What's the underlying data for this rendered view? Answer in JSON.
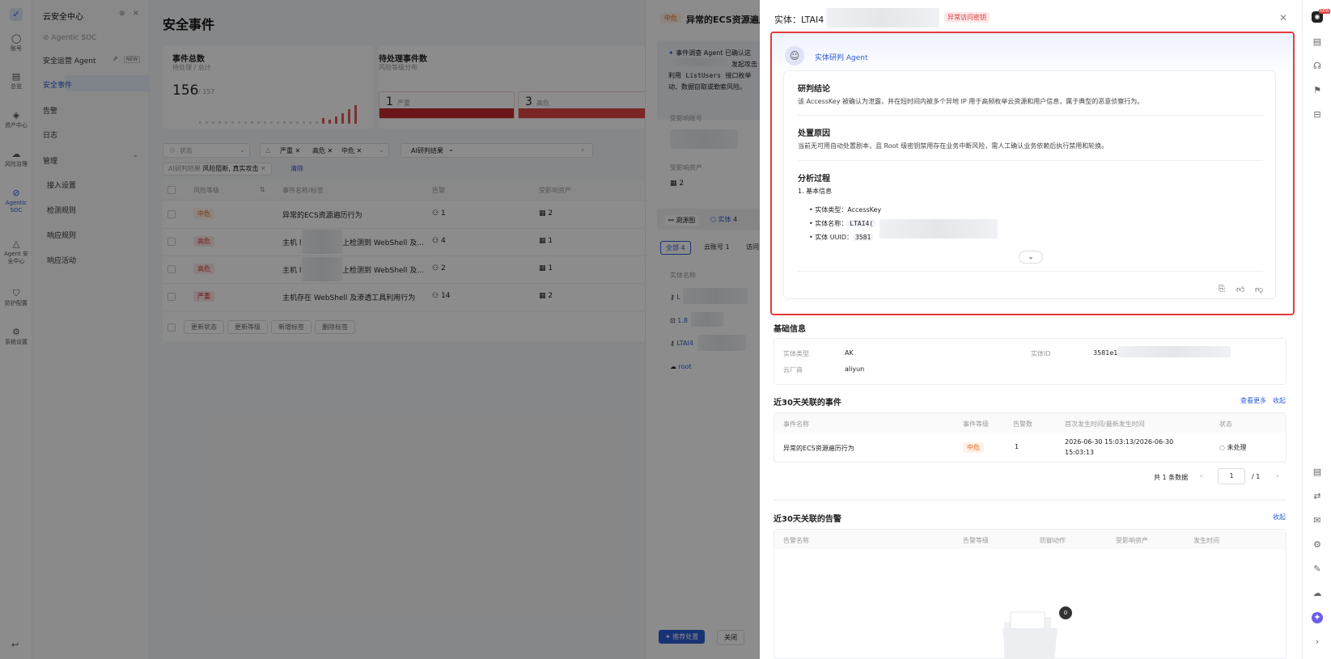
{
  "rail": {
    "items": [
      {
        "label": "账号",
        "icon": "user-icon"
      },
      {
        "label": "总览",
        "icon": "dashboard-icon"
      },
      {
        "label": "资产中心",
        "icon": "cube-icon"
      },
      {
        "label": "风险治理",
        "icon": "cloud-icon"
      },
      {
        "label": "Agentic SOC",
        "icon": "agentic-icon"
      },
      {
        "label": "Agent 安全中心",
        "icon": "triangle-icon"
      },
      {
        "label": "防护配置",
        "icon": "shield-icon"
      },
      {
        "label": "系统设置",
        "icon": "gear-icon"
      }
    ]
  },
  "menu": {
    "app_title": "云安全中心",
    "section": "Agentic SOC",
    "items": [
      "安全运营 Agent",
      "安全事件",
      "告警",
      "日志"
    ],
    "new_badge": "NEW",
    "group": "管理",
    "sub_items": [
      "接入设置",
      "检测规则",
      "响应规则",
      "响应活动"
    ]
  },
  "main": {
    "title": "安全事件",
    "stat1": {
      "title": "事件总数",
      "subtitle": "待处理 / 总计",
      "value": "156",
      "total": "/ 157"
    },
    "stat2": {
      "title": "待处理事件数",
      "subtitle": "风险等级分布",
      "sev1_count": "1",
      "sev1_label": "严重",
      "sev2_count": "3",
      "sev2_label": "高危"
    },
    "filters": {
      "status_placeholder": "状态",
      "tags": [
        "严重",
        "高危",
        "中危"
      ],
      "ai_filter": "AI研判结果",
      "chip_label": "AI研判结果",
      "chip_value": "风险阻断, 真实攻击",
      "clear": "清除"
    },
    "table": {
      "headers": [
        "风险等级",
        "事件名称/标签",
        "告警",
        "受影响资产"
      ],
      "rows": [
        {
          "level": "中危",
          "kind": "mid",
          "name": "异常的ECS资源遍历行为",
          "alerts": "1",
          "assets": "2"
        },
        {
          "level": "高危",
          "kind": "high",
          "name": "主机 ly",
          "name_tail": "上检测到 WebShell 及...",
          "alerts": "4",
          "assets": "1"
        },
        {
          "level": "高危",
          "kind": "high",
          "name": "主机 ly",
          "name_tail": "上检测到 WebShell 及...",
          "alerts": "2",
          "assets": "1"
        },
        {
          "level": "严重",
          "kind": "sev",
          "name": "主机存在 WebShell 及渗透工具利用行为",
          "alerts": "14",
          "assets": "2"
        }
      ],
      "actions": [
        "更新状态",
        "更新等级",
        "新增标签",
        "删除标签"
      ]
    }
  },
  "mid": {
    "level": "中危",
    "title": "异常的ECS资源遍历行",
    "info_prefix": "事件调查 Agent 已确认这",
    "info_line2": "发起攻击",
    "info_line3a": "利用",
    "info_code": "ListUsers",
    "info_line3b": "接口枚举",
    "info_line4": "动、数据窃取或勒索风险。",
    "account_label": "受影响账号",
    "asset_label": "受影响资产",
    "asset_count": "2",
    "tabs": [
      "溯源图",
      "实体"
    ],
    "entity_count": "4",
    "subtabs": [
      "全部 4",
      "云账号 1",
      "访问"
    ],
    "entity_header": "实体名称",
    "entities": [
      "L",
      "1.8",
      "LTAI4",
      "root"
    ],
    "primary_btn": "推荐处置",
    "close_btn": "关闭"
  },
  "drawer": {
    "title": "实体：LTAI4",
    "tag": "异常访问密钥",
    "agent": {
      "name": "实体研判 Agent",
      "conclusion_title": "研判结论",
      "conclusion": "该 AccessKey 被确认为泄露，并在短时间内被多个异地 IP 用于高频枚举云资源和用户信息，属于典型的恶意侦察行为。",
      "reason_title": "处置原因",
      "reason": "当前无可用自动处置剧本，且 Root 级密钥禁用存在业务中断风险，需人工确认业务依赖后执行禁用和轮换。",
      "process_title": "分析过程",
      "process_sub": "1. 基本信息",
      "bullets": [
        {
          "label": "实体类型：",
          "value": "AccessKey"
        },
        {
          "label": "实体名称：",
          "value": "LTAI4("
        },
        {
          "label": "实体 UUID：",
          "value": "3581"
        }
      ]
    },
    "basic": {
      "title": "基础信息",
      "type_label": "实体类型",
      "type_value": "AK",
      "id_label": "实体ID",
      "id_value": "3581e1",
      "vendor_label": "云厂商",
      "vendor_value": "aliyun"
    },
    "events": {
      "title": "近30天关联的事件",
      "more": "查看更多",
      "collapse": "收起",
      "headers": [
        "事件名称",
        "事件等级",
        "告警数",
        "首次发生时间/最新发生时间",
        "状态"
      ],
      "row": {
        "name": "异常的ECS资源遍历行为",
        "level": "中危",
        "count": "1",
        "time1": "2026-06-30 15:03:13/2026-06-30",
        "time2": "15:03:13",
        "status": "未处理"
      },
      "total": "共 1 条数据",
      "page": "1",
      "pages": "/ 1"
    },
    "alerts": {
      "title": "近30天关联的告警",
      "collapse": "收起",
      "headers": [
        "告警名称",
        "告警等级",
        "防御动作",
        "受影响资产",
        "发生时间"
      ],
      "empty_count": "0"
    }
  },
  "rrail": {
    "new_badge": "NEW"
  }
}
